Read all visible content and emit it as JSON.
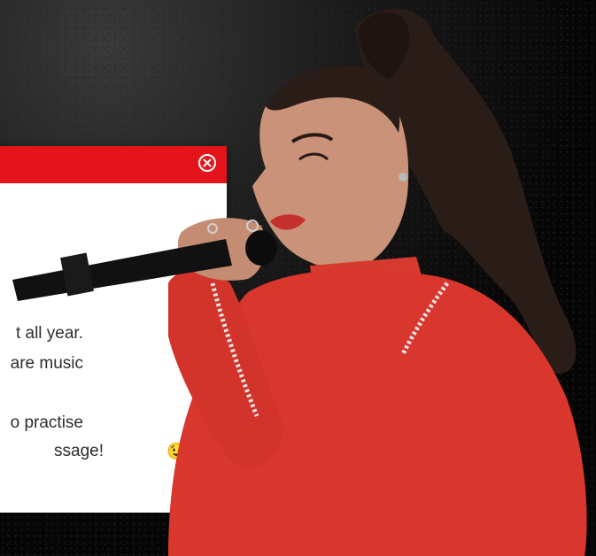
{
  "popup": {
    "close_icon": "close-circle-icon",
    "lines": [
      "t all year.",
      "are music",
      "o practise",
      "ssage!"
    ],
    "emoji": "😉"
  },
  "photo": {
    "subject": "singer-with-microphone"
  },
  "colors": {
    "header_red": "#e3141a",
    "jacket_red": "#d9362d",
    "background": "#000000"
  }
}
